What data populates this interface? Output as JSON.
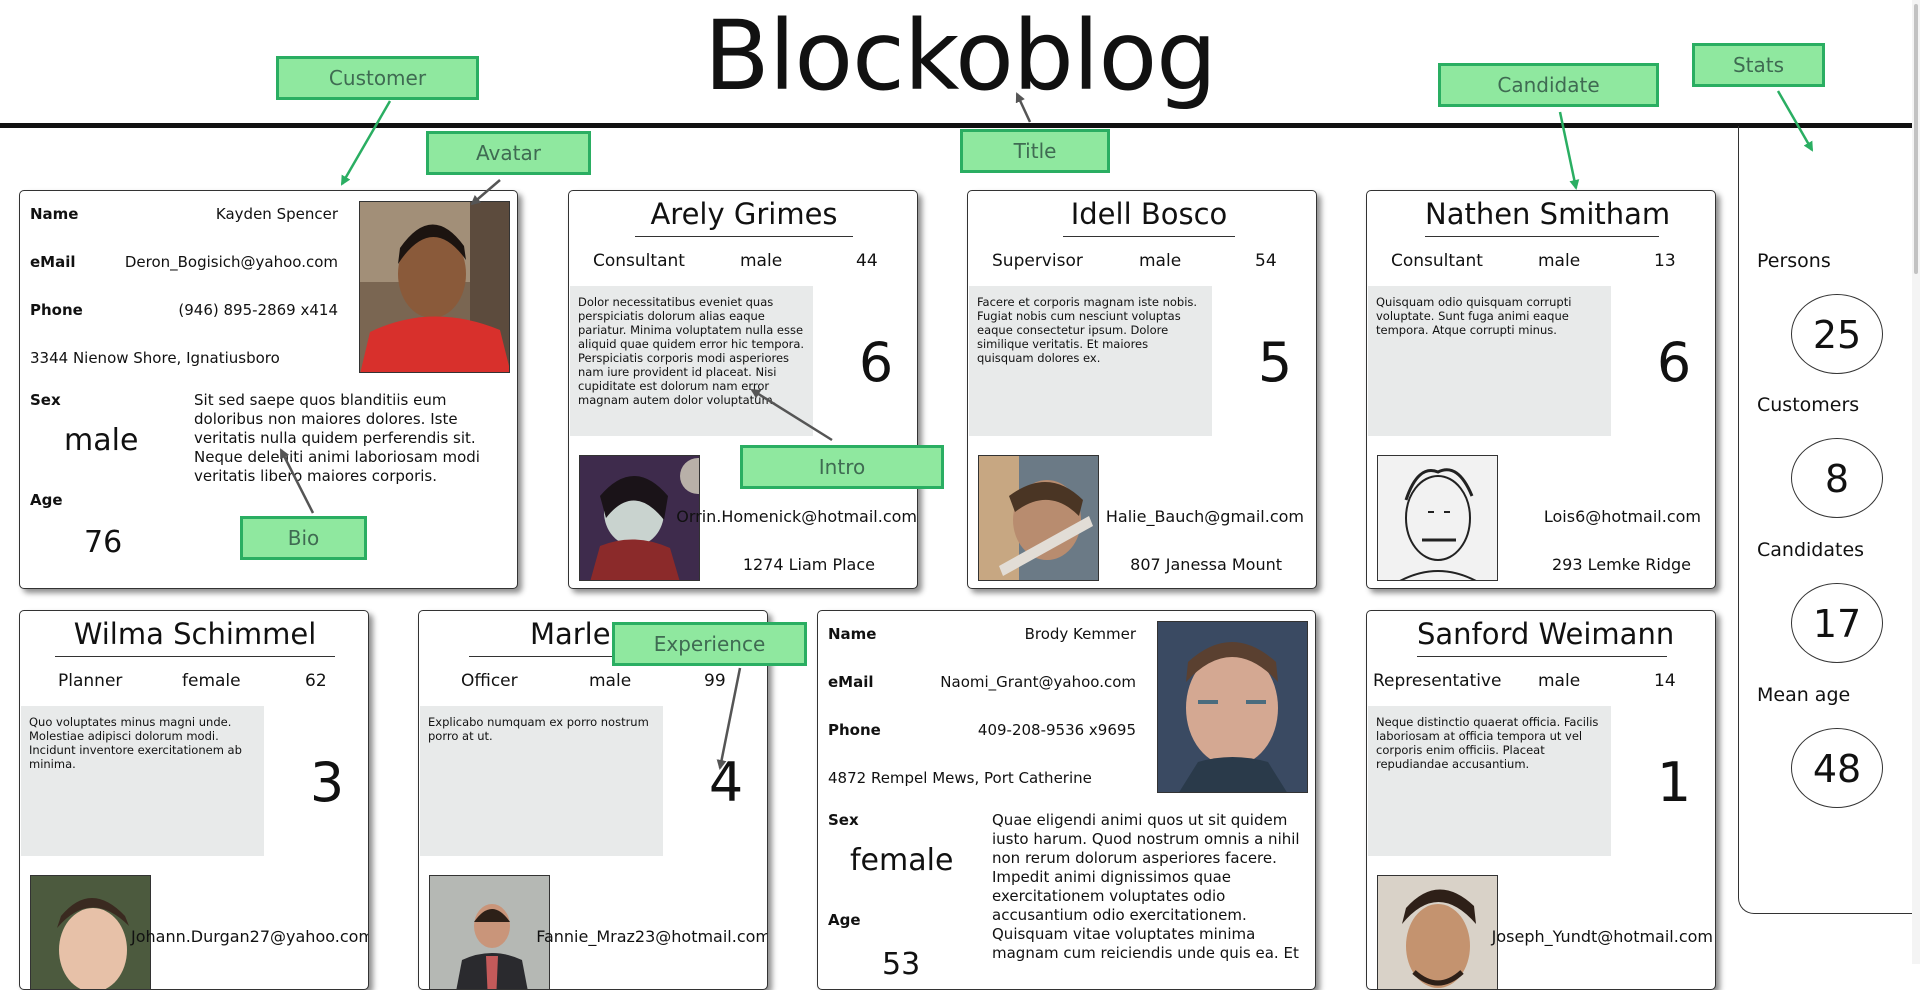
{
  "title": "Blockoblog",
  "customers": [
    {
      "labels": {
        "name": "Name",
        "email": "eMail",
        "phone": "Phone",
        "sex": "Sex",
        "age": "Age"
      },
      "name": "Kayden Spencer",
      "email": "Deron_Bogisich@yahoo.com",
      "phone": "(946) 895-2869 x414",
      "address": "3344 Nienow Shore, Ignatiusboro",
      "sex": "male",
      "age": "76",
      "bio": "Sit sed saepe quos blanditiis eum doloribus non maiores dolores. Iste veritatis nulla quidem perferendis sit. Neque deleniti animi laboriosam modi veritatis libero maiores corporis."
    },
    {
      "labels": {
        "name": "Name",
        "email": "eMail",
        "phone": "Phone",
        "sex": "Sex",
        "age": "Age"
      },
      "name": "Brody Kemmer",
      "email": "Naomi_Grant@yahoo.com",
      "phone": "409-208-9536 x9695",
      "address": "4872 Rempel Mews, Port Catherine",
      "sex": "female",
      "age": "53",
      "bio": "Quae eligendi animi quos ut sit quidem iusto harum. Quod nostrum omnis a nihil non rerum dolorum asperiores facere. Impedit animi dignissimos quae exercitationem voluptates odio accusantium odio exercitationem. Quisquam vitae voluptates minima magnam cum reiciendis unde quis ea. Et"
    }
  ],
  "candidates": [
    {
      "name": "Arely Grimes",
      "role": "Consultant",
      "sex": "male",
      "age": "44",
      "intro": "Dolor necessitatibus eveniet quas perspiciatis dolorum alias eaque pariatur. Minima voluptatem nulla esse aliquid quae quidem error hic tempora. Perspiciatis corporis modi asperiores nam iure provident id placeat. Nisi cupiditate est dolorum nam error magnam autem dolor voluptatum.",
      "experience": "6",
      "email": "Orrin.Homenick@hotmail.com",
      "address": "1274 Liam Place"
    },
    {
      "name": "Idell Bosco",
      "role": "Supervisor",
      "sex": "male",
      "age": "54",
      "intro": "Facere et corporis magnam iste nobis. Fugiat nobis cum nesciunt voluptas eaque consectetur ipsum. Dolore similique veritatis. Et maiores quisquam dolores ex.",
      "experience": "5",
      "email": "Halie_Bauch@gmail.com",
      "address": "807 Janessa Mount"
    },
    {
      "name": "Nathen Smitham",
      "role": "Consultant",
      "sex": "male",
      "age": "13",
      "intro": "Quisquam odio quisquam corrupti voluptate. Sunt fuga animi eaque tempora. Atque corrupti minus.",
      "experience": "6",
      "email": "Lois6@hotmail.com",
      "address": "293 Lemke Ridge"
    },
    {
      "name": "Wilma Schimmel",
      "role": "Planner",
      "sex": "female",
      "age": "62",
      "intro": "Quo voluptates minus magni unde. Molestiae adipisci dolorum modi. Incidunt inventore exercitationem ab minima.",
      "experience": "3",
      "email": "Johann.Durgan27@yahoo.com",
      "address": ""
    },
    {
      "name": "Marlen B",
      "role": "Officer",
      "sex": "male",
      "age": "99",
      "intro": "Explicabo numquam ex porro nostrum porro at ut.",
      "experience": "4",
      "email": "Fannie_Mraz23@hotmail.com",
      "address": ""
    },
    {
      "name": "Sanford Weimann",
      "role": "Representative",
      "sex": "male",
      "age": "14",
      "intro": "Neque distinctio quaerat officia. Facilis laboriosam at officia tempora ut vel corporis enim officiis. Placeat repudiandae accusantium.",
      "experience": "1",
      "email": "Joseph_Yundt@hotmail.com",
      "address": ""
    }
  ],
  "stats": {
    "persons_label": "Persons",
    "persons": "25",
    "customers_label": "Customers",
    "customers": "8",
    "candidates_label": "Candidates",
    "candidates": "17",
    "mean_age_label": "Mean age",
    "mean_age": "48"
  },
  "annotations": {
    "customer": "Customer",
    "avatar": "Avatar",
    "title": "Title",
    "candidate": "Candidate",
    "stats": "Stats",
    "intro": "Intro",
    "bio": "Bio",
    "experience": "Experience"
  },
  "colors": {
    "annotation_fill": "#8fe89f",
    "annotation_border": "#2aae62",
    "intro_bg": "#e8eaea"
  },
  "icons": {
    "photos": "person-photo"
  }
}
